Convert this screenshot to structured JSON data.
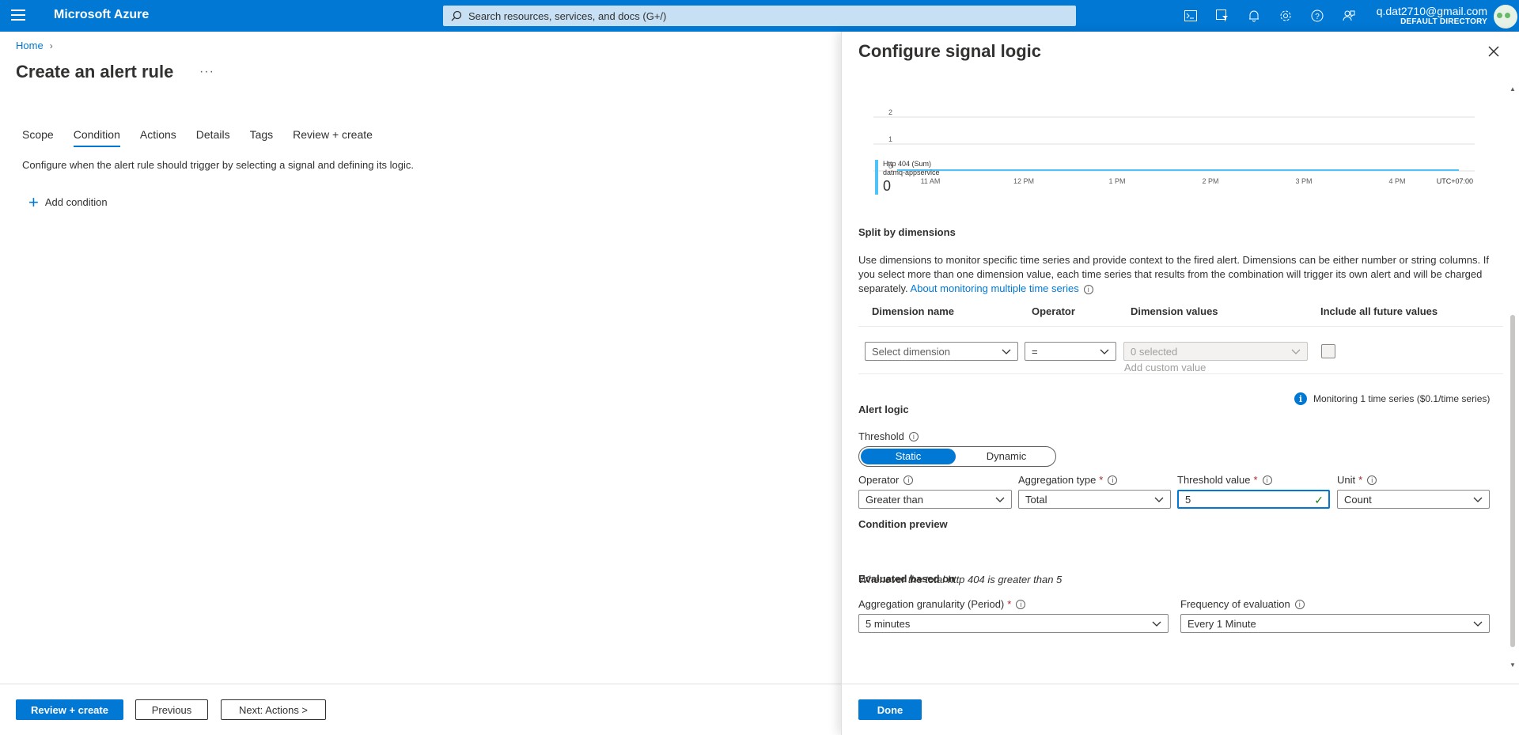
{
  "topbar": {
    "brand": "Microsoft Azure",
    "search_placeholder": "Search resources, services, and docs (G+/)",
    "user_email": "q.dat2710@gmail.com",
    "user_directory": "DEFAULT DIRECTORY",
    "icons": [
      "cloud-shell-icon",
      "directory-filter-icon",
      "notifications-icon",
      "settings-icon",
      "help-icon",
      "feedback-icon"
    ]
  },
  "page": {
    "breadcrumb_home": "Home",
    "title": "Create an alert rule",
    "more": "···",
    "tabs": [
      "Scope",
      "Condition",
      "Actions",
      "Details",
      "Tags",
      "Review + create"
    ],
    "active_tab": "Condition",
    "description": "Configure when the alert rule should trigger by selecting a signal and defining its logic.",
    "add_condition": "Add condition",
    "footer": {
      "review_create": "Review + create",
      "previous": "Previous",
      "next": "Next: Actions >"
    }
  },
  "panel": {
    "title": "Configure signal logic",
    "legend": {
      "series_name": "Http 404 (Sum)",
      "resource": "datmq-appservice",
      "value": "0"
    },
    "split": {
      "title": "Split by dimensions",
      "description": "Use dimensions to monitor specific time series and provide context to the fired alert. Dimensions can be either number or string columns. If you select more than one dimension value, each time series that results from the combination will trigger its own alert and will be charged separately.",
      "link": "About monitoring multiple time series",
      "headers": {
        "name": "Dimension name",
        "operator": "Operator",
        "values": "Dimension values",
        "future": "Include all future values"
      },
      "row": {
        "dimension": "Select dimension",
        "operator": "=",
        "values": "0 selected",
        "add_custom": "Add custom value"
      }
    },
    "monitoring_info": "Monitoring 1 time series ($0.1/time series)",
    "alert_logic": {
      "title": "Alert logic",
      "threshold_label": "Threshold",
      "threshold_options": [
        "Static",
        "Dynamic"
      ],
      "threshold_selected": "Static",
      "operator_label": "Operator",
      "operator_value": "Greater than",
      "aggregation_label": "Aggregation type",
      "aggregation_value": "Total",
      "threshold_value_label": "Threshold value",
      "threshold_value": "5",
      "unit_label": "Unit",
      "unit_value": "Count"
    },
    "preview": {
      "title": "Condition preview",
      "text": "Whenever the total http 404 is greater than 5"
    },
    "evaluation": {
      "title": "Evaluated based on",
      "granularity_label": "Aggregation granularity (Period)",
      "granularity_value": "5 minutes",
      "frequency_label": "Frequency of evaluation",
      "frequency_value": "Every 1 Minute"
    },
    "done": "Done"
  },
  "chart_data": {
    "type": "line",
    "x": [
      "11 AM",
      "12 PM",
      "1 PM",
      "2 PM",
      "3 PM",
      "4 PM"
    ],
    "timezone_label": "UTC+07:00",
    "y_ticks": [
      "0",
      "1",
      "2"
    ],
    "series": [
      {
        "name": "Http 404 (Sum)",
        "values": [
          0,
          0,
          0,
          0,
          0,
          0
        ]
      }
    ],
    "ylim": [
      0,
      2
    ],
    "color": "#4fc3f7"
  }
}
